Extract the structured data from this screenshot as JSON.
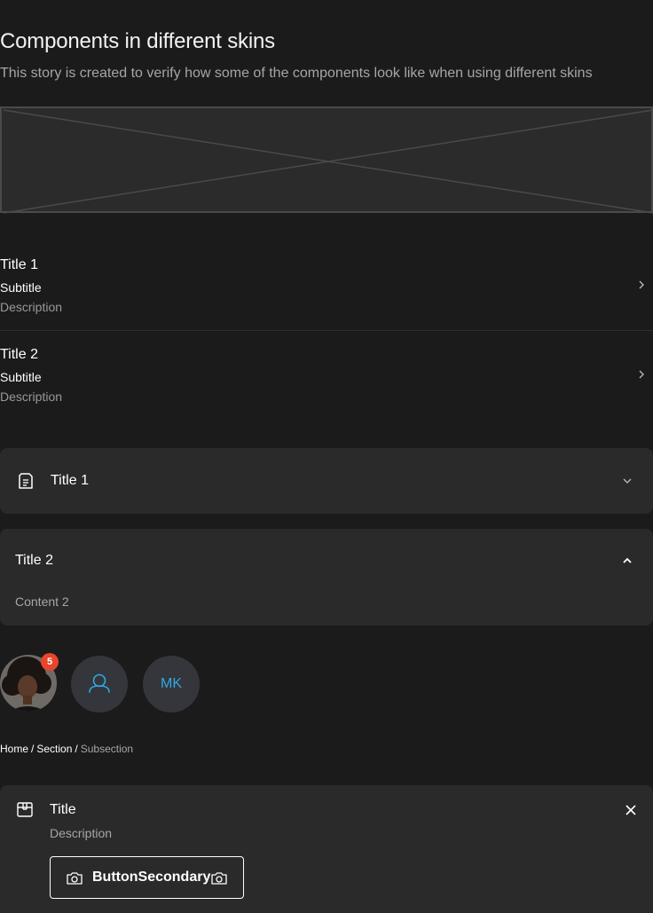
{
  "story": {
    "title": "Components in different skins",
    "description": "This story is created to verify how some of the components look like when using different skins"
  },
  "list": {
    "items": [
      {
        "title": "Title 1",
        "subtitle": "Subtitle",
        "description": "Description"
      },
      {
        "title": "Title 2",
        "subtitle": "Subtitle",
        "description": "Description"
      }
    ]
  },
  "accordion": {
    "items": [
      {
        "title": "Title 1",
        "icon": "document-icon",
        "expanded": false
      },
      {
        "title": "Title 2",
        "content": "Content 2",
        "expanded": true
      }
    ]
  },
  "avatars": {
    "badge_count": "5",
    "initials": "MK",
    "icon": "user-icon",
    "accent_color": "#2fa8e0"
  },
  "breadcrumb": {
    "items": [
      "Home",
      "Section",
      "Subsection"
    ],
    "separator": "/"
  },
  "notification": {
    "title": "Title",
    "description": "Description",
    "icon": "package-icon",
    "button_label": "ButtonSecondary",
    "button_icon": "camera-icon",
    "close_icon": "close-icon"
  },
  "colors": {
    "background": "#1b1b1c",
    "surface": "#2a2a2b",
    "accent": "#2fa8e0",
    "badge": "#e8452c"
  }
}
